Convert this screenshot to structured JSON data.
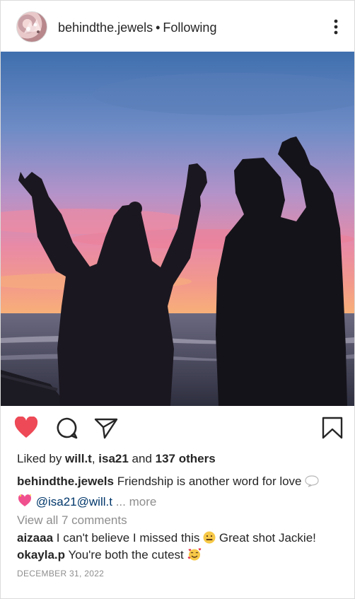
{
  "header": {
    "username": "behindthe.jewels",
    "separator": "•",
    "follow_status": "Following"
  },
  "icons": {
    "more": "more-vertical-icon",
    "like": "heart-filled-icon",
    "comment": "comment-bubble-icon",
    "share": "paper-plane-icon",
    "save": "bookmark-icon"
  },
  "colors": {
    "like": "#ed4956",
    "link": "#00376b",
    "muted": "#8e8e8e"
  },
  "likes": {
    "prefix": "Liked by ",
    "user1": "will.t",
    "sep1": ", ",
    "user2": "isa21",
    "and": " and ",
    "others": "137 others"
  },
  "caption": {
    "username": "behindthe.jewels",
    "text": "Friendship is another word for love",
    "tags": "@isa21@will.t",
    "more": "... more"
  },
  "view_comments": "View all 7 comments",
  "comments": [
    {
      "user": "aizaaa",
      "text": "I can't believe I missed this",
      "text2": "Great shot Jackie!"
    },
    {
      "user": "okayla.p",
      "text": "You're both the cutest"
    }
  ],
  "date": "DECEMBER 31, 2022"
}
